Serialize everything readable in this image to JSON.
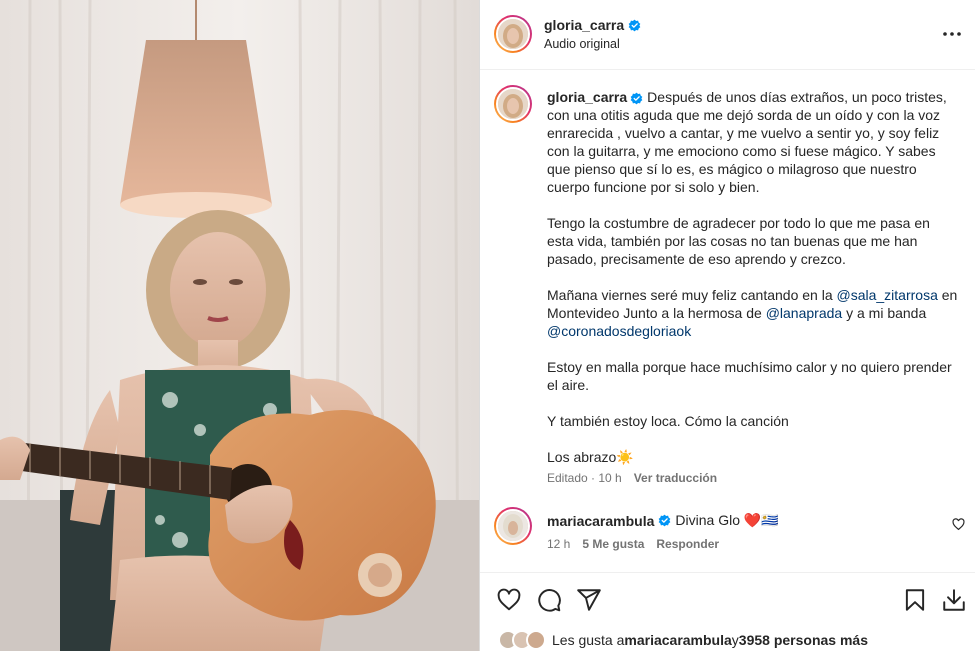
{
  "post": {
    "username": "gloria_carra",
    "audio": "Audio original"
  },
  "caption": {
    "username": "gloria_carra",
    "p1": "Después de unos días extraños, un poco tristes, con una otitis aguda que me dejó sorda de un oído y con la voz enrarecida , vuelvo a cantar, y me vuelvo a sentir yo, y soy feliz con la guitarra, y me emociono como si fuese mágico. Y sabes que pienso que sí lo es, es mágico o milagroso que nuestro cuerpo funcione por si solo y bien.",
    "p2": "Tengo la costumbre de agradecer por todo lo que me pasa en esta vida, también por las cosas no tan buenas que me han pasado, precisamente de eso aprendo y crezco.",
    "p3_a": "Mañana viernes seré muy feliz cantando en la ",
    "mention1": "@sala_zitarrosa",
    "p3_b": " en Montevideo Junto a la hermosa de ",
    "mention2": "@lanaprada",
    "p3_c": " y a mi banda ",
    "mention3": "@coronadosdegloriaok",
    "p4": "Estoy en malla porque hace muchísimo calor y no quiero prender el aire.",
    "p5": "Y también estoy loca. Cómo la canción",
    "p6": "Los abrazo☀️",
    "edited": "Editado · 10 h",
    "translate": "Ver traducción"
  },
  "comment": {
    "username": "mariacarambula",
    "text": "Divina Glo ❤️🇺🇾",
    "time": "12 h",
    "likes": "5 Me gusta",
    "reply": "Responder"
  },
  "likes": {
    "prefix": "Les gusta a ",
    "user": "mariacarambula",
    "middle": " y ",
    "count": "3958 personas más"
  },
  "colors": {
    "verified": "#0095f6",
    "mention": "#00376b",
    "secondary_text": "#737373"
  },
  "icons": [
    "more-options-icon",
    "verified-icon",
    "heart-icon",
    "comment-icon",
    "share-icon",
    "bookmark-icon",
    "download-icon"
  ]
}
